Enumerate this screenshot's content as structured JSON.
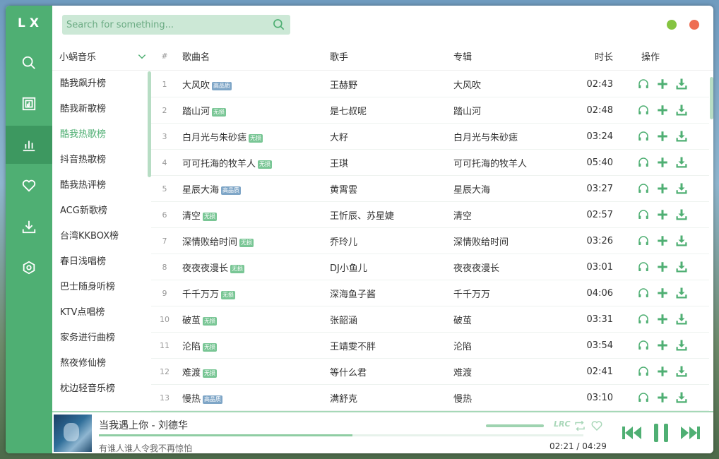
{
  "app": {
    "logo": "LX"
  },
  "search": {
    "placeholder": "Search for something..."
  },
  "boards": {
    "source": "小蜗音乐",
    "items": [
      "酷我飙升榜",
      "酷我新歌榜",
      "酷我热歌榜",
      "抖音热歌榜",
      "酷我热评榜",
      "ACG新歌榜",
      "台湾KKBOX榜",
      "春日浅唱榜",
      "巴士随身听榜",
      "KTV点唱榜",
      "家务进行曲榜",
      "熬夜修仙榜",
      "枕边轻音乐榜"
    ],
    "active_index": 2
  },
  "table": {
    "headers": {
      "no": "#",
      "name": "歌曲名",
      "singer": "歌手",
      "album": "专辑",
      "time": "时长",
      "ops": "操作"
    },
    "rows": [
      {
        "no": "1",
        "name": "大风吹",
        "tag": "高品质",
        "tag_type": "hq",
        "singer": "王赫野",
        "album": "大风吹",
        "time": "02:43"
      },
      {
        "no": "2",
        "name": "踏山河",
        "tag": "无损",
        "tag_type": "ls",
        "singer": "是七叔呢",
        "album": "踏山河",
        "time": "02:48"
      },
      {
        "no": "3",
        "name": "白月光与朱砂痣",
        "tag": "无损",
        "tag_type": "ls",
        "singer": "大籽",
        "album": "白月光与朱砂痣",
        "time": "03:24"
      },
      {
        "no": "4",
        "name": "可可托海的牧羊人",
        "tag": "无损",
        "tag_type": "ls",
        "singer": "王琪",
        "album": "可可托海的牧羊人",
        "time": "05:40"
      },
      {
        "no": "5",
        "name": "星辰大海",
        "tag": "高品质",
        "tag_type": "hq",
        "singer": "黄霄雲",
        "album": "星辰大海",
        "time": "03:27"
      },
      {
        "no": "6",
        "name": "清空",
        "tag": "无损",
        "tag_type": "ls",
        "singer": "王忻辰、苏星婕",
        "album": "清空",
        "time": "02:57"
      },
      {
        "no": "7",
        "name": "深情败给时间",
        "tag": "无损",
        "tag_type": "ls",
        "singer": "乔玲儿",
        "album": "深情败给时间",
        "time": "03:26"
      },
      {
        "no": "8",
        "name": "夜夜夜漫长",
        "tag": "无损",
        "tag_type": "ls",
        "singer": "DJ小鱼儿",
        "album": "夜夜夜漫长",
        "time": "03:01"
      },
      {
        "no": "9",
        "name": "千千万万",
        "tag": "无损",
        "tag_type": "ls",
        "singer": "深海鱼子酱",
        "album": "千千万万",
        "time": "04:06"
      },
      {
        "no": "10",
        "name": "破茧",
        "tag": "无损",
        "tag_type": "ls",
        "singer": "张韶涵",
        "album": "破茧",
        "time": "03:31"
      },
      {
        "no": "11",
        "name": "沦陷",
        "tag": "无损",
        "tag_type": "ls",
        "singer": "王靖雯不胖",
        "album": "沦陷",
        "time": "03:54"
      },
      {
        "no": "12",
        "name": "难渡",
        "tag": "无损",
        "tag_type": "ls",
        "singer": "等什么君",
        "album": "难渡",
        "time": "02:41"
      },
      {
        "no": "13",
        "name": "慢热",
        "tag": "高品质",
        "tag_type": "hq",
        "singer": "满舒克",
        "album": "慢热",
        "time": "03:10"
      }
    ]
  },
  "player": {
    "title": "当我遇上你 - 刘德华",
    "lyric": "有谁人谁人令我不再惊怕",
    "current_time": "02:21",
    "separator": "/",
    "total_time": "04:29",
    "progress": 0.524,
    "volume": 1.0,
    "lrc_label": "LRC"
  },
  "colors": {
    "accent": "#4faf73",
    "accent_dark": "#3d9860",
    "tag_hq": "#7fa6c7",
    "tag_ls": "#79c695",
    "min_dot": "#85c441",
    "close_dot": "#ee6d52"
  },
  "icons": {
    "nav": [
      "search-icon",
      "music-list-icon",
      "chart-icon",
      "heart-icon",
      "download-icon",
      "settings-icon"
    ],
    "row_ops": [
      "headphones-icon",
      "plus-icon",
      "download-icon"
    ]
  }
}
